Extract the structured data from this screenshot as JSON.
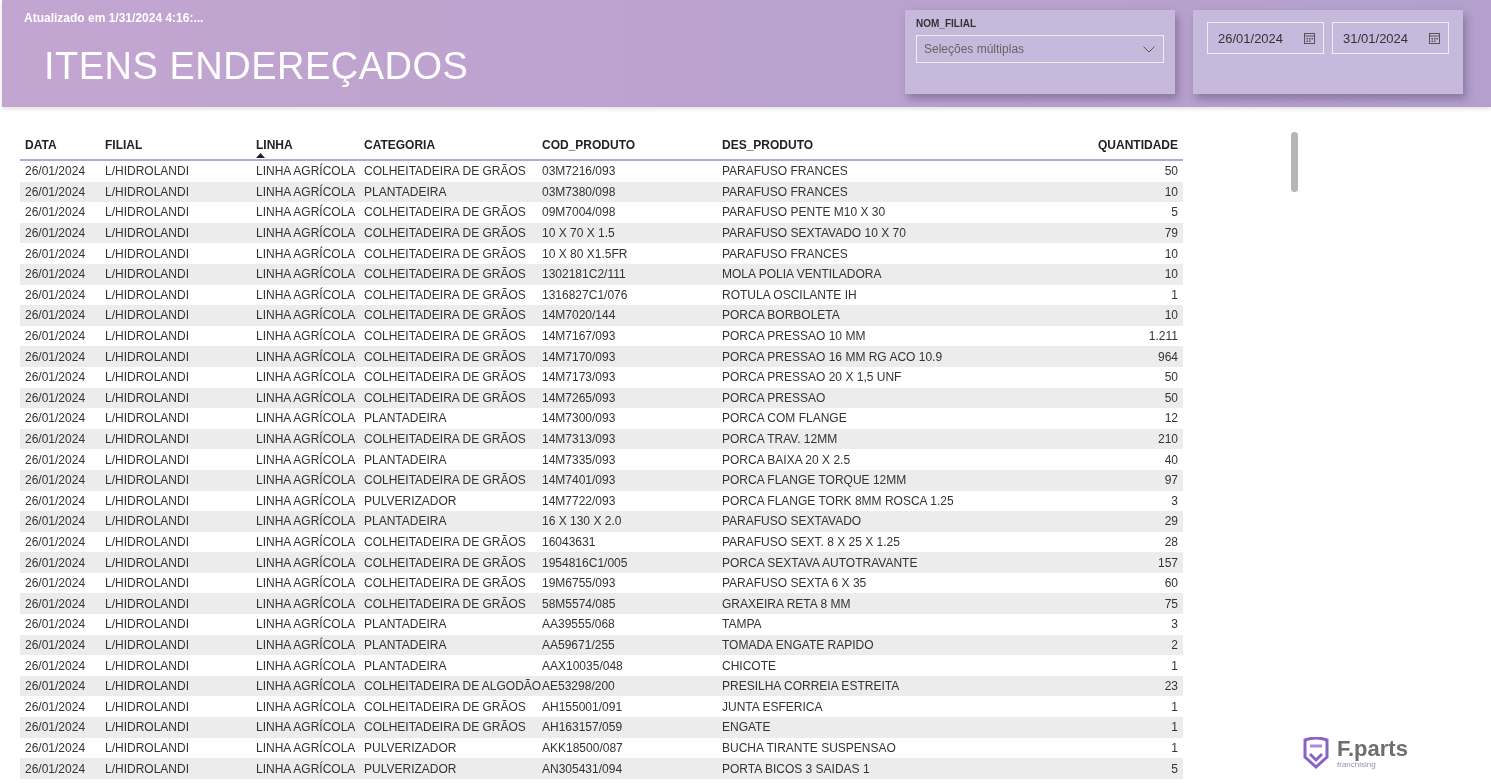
{
  "header": {
    "updated": "Atualizado em 1/31/2024 4:16:...",
    "title": "ITENS ENDEREÇADOS"
  },
  "slicers": {
    "branch": {
      "label": "NOM_FILIAL",
      "value": "Seleções múltiplas"
    },
    "date_range": {
      "start": "26/01/2024",
      "end": "31/01/2024"
    }
  },
  "table": {
    "columns": [
      {
        "label": "DATA",
        "sorted": false
      },
      {
        "label": "FILIAL",
        "sorted": false
      },
      {
        "label": "LINHA",
        "sorted": true
      },
      {
        "label": "CATEGORIA",
        "sorted": false
      },
      {
        "label": "COD_PRODUTO",
        "sorted": false
      },
      {
        "label": "DES_PRODUTO",
        "sorted": false
      },
      {
        "label": "QUANTIDADE",
        "sorted": false
      }
    ],
    "rows": [
      [
        "26/01/2024",
        "L/HIDROLANDI",
        "LINHA AGRÍCOLA",
        "COLHEITADEIRA DE GRÃOS",
        "03M7216/093",
        "PARAFUSO FRANCES",
        "50"
      ],
      [
        "26/01/2024",
        "L/HIDROLANDI",
        "LINHA AGRÍCOLA",
        "PLANTADEIRA",
        "03M7380/098",
        "PARAFUSO FRANCES",
        "10"
      ],
      [
        "26/01/2024",
        "L/HIDROLANDI",
        "LINHA AGRÍCOLA",
        "COLHEITADEIRA DE GRÃOS",
        "09M7004/098",
        "PARAFUSO PENTE M10 X 30",
        "5"
      ],
      [
        "26/01/2024",
        "L/HIDROLANDI",
        "LINHA AGRÍCOLA",
        "COLHEITADEIRA DE GRÃOS",
        "10 X 70 X 1.5",
        "PARAFUSO SEXTAVADO 10 X 70",
        "79"
      ],
      [
        "26/01/2024",
        "L/HIDROLANDI",
        "LINHA AGRÍCOLA",
        "COLHEITADEIRA DE GRÃOS",
        "10 X 80 X1.5FR",
        "PARAFUSO FRANCES",
        "10"
      ],
      [
        "26/01/2024",
        "L/HIDROLANDI",
        "LINHA AGRÍCOLA",
        "COLHEITADEIRA DE GRÃOS",
        "1302181C2/111",
        "MOLA POLIA VENTILADORA",
        "10"
      ],
      [
        "26/01/2024",
        "L/HIDROLANDI",
        "LINHA AGRÍCOLA",
        "COLHEITADEIRA DE GRÃOS",
        "1316827C1/076",
        "ROTULA OSCILANTE IH",
        "1"
      ],
      [
        "26/01/2024",
        "L/HIDROLANDI",
        "LINHA AGRÍCOLA",
        "COLHEITADEIRA DE GRÃOS",
        "14M7020/144",
        "PORCA BORBOLETA",
        "10"
      ],
      [
        "26/01/2024",
        "L/HIDROLANDI",
        "LINHA AGRÍCOLA",
        "COLHEITADEIRA DE GRÃOS",
        "14M7167/093",
        "PORCA PRESSAO 10 MM",
        "1.211"
      ],
      [
        "26/01/2024",
        "L/HIDROLANDI",
        "LINHA AGRÍCOLA",
        "COLHEITADEIRA DE GRÃOS",
        "14M7170/093",
        "PORCA PRESSAO 16 MM RG ACO 10.9",
        "964"
      ],
      [
        "26/01/2024",
        "L/HIDROLANDI",
        "LINHA AGRÍCOLA",
        "COLHEITADEIRA DE GRÃOS",
        "14M7173/093",
        "PORCA PRESSAO 20 X 1,5 UNF",
        "50"
      ],
      [
        "26/01/2024",
        "L/HIDROLANDI",
        "LINHA AGRÍCOLA",
        "COLHEITADEIRA DE GRÃOS",
        "14M7265/093",
        "PORCA PRESSAO",
        "50"
      ],
      [
        "26/01/2024",
        "L/HIDROLANDI",
        "LINHA AGRÍCOLA",
        "PLANTADEIRA",
        "14M7300/093",
        "PORCA COM FLANGE",
        "12"
      ],
      [
        "26/01/2024",
        "L/HIDROLANDI",
        "LINHA AGRÍCOLA",
        "COLHEITADEIRA DE GRÃOS",
        "14M7313/093",
        "PORCA TRAV. 12MM",
        "210"
      ],
      [
        "26/01/2024",
        "L/HIDROLANDI",
        "LINHA AGRÍCOLA",
        "PLANTADEIRA",
        "14M7335/093",
        "PORCA BAIXA 20 X 2.5",
        "40"
      ],
      [
        "26/01/2024",
        "L/HIDROLANDI",
        "LINHA AGRÍCOLA",
        "COLHEITADEIRA DE GRÃOS",
        "14M7401/093",
        "PORCA FLANGE TORQUE 12MM",
        "97"
      ],
      [
        "26/01/2024",
        "L/HIDROLANDI",
        "LINHA AGRÍCOLA",
        "PULVERIZADOR",
        "14M7722/093",
        "PORCA FLANGE TORK 8MM ROSCA 1.25",
        "3"
      ],
      [
        "26/01/2024",
        "L/HIDROLANDI",
        "LINHA AGRÍCOLA",
        "PLANTADEIRA",
        "16 X 130 X 2.0",
        "PARAFUSO SEXTAVADO",
        "29"
      ],
      [
        "26/01/2024",
        "L/HIDROLANDI",
        "LINHA AGRÍCOLA",
        "COLHEITADEIRA DE GRÃOS",
        "16043631",
        "PARAFUSO SEXT. 8 X 25 X 1.25",
        "28"
      ],
      [
        "26/01/2024",
        "L/HIDROLANDI",
        "LINHA AGRÍCOLA",
        "COLHEITADEIRA DE GRÃOS",
        "1954816C1/005",
        "PORCA SEXTAVA AUTOTRAVANTE",
        "157"
      ],
      [
        "26/01/2024",
        "L/HIDROLANDI",
        "LINHA AGRÍCOLA",
        "COLHEITADEIRA DE GRÃOS",
        "19M6755/093",
        "PARAFUSO SEXTA 6 X 35",
        "60"
      ],
      [
        "26/01/2024",
        "L/HIDROLANDI",
        "LINHA AGRÍCOLA",
        "COLHEITADEIRA DE GRÃOS",
        "58M5574/085",
        "GRAXEIRA RETA 8 MM",
        "75"
      ],
      [
        "26/01/2024",
        "L/HIDROLANDI",
        "LINHA AGRÍCOLA",
        "PLANTADEIRA",
        "AA39555/068",
        "TAMPA",
        "3"
      ],
      [
        "26/01/2024",
        "L/HIDROLANDI",
        "LINHA AGRÍCOLA",
        "PLANTADEIRA",
        "AA59671/255",
        "TOMADA ENGATE RAPIDO",
        "2"
      ],
      [
        "26/01/2024",
        "L/HIDROLANDI",
        "LINHA AGRÍCOLA",
        "PLANTADEIRA",
        "AAX10035/048",
        "CHICOTE",
        "1"
      ],
      [
        "26/01/2024",
        "L/HIDROLANDI",
        "LINHA AGRÍCOLA",
        "COLHEITADEIRA DE ALGODÃO",
        "AE53298/200",
        "PRESILHA CORREIA ESTREITA",
        "23"
      ],
      [
        "26/01/2024",
        "L/HIDROLANDI",
        "LINHA AGRÍCOLA",
        "COLHEITADEIRA DE GRÃOS",
        "AH155001/091",
        "JUNTA ESFERICA",
        "1"
      ],
      [
        "26/01/2024",
        "L/HIDROLANDI",
        "LINHA AGRÍCOLA",
        "COLHEITADEIRA DE GRÃOS",
        "AH163157/059",
        "ENGATE",
        "1"
      ],
      [
        "26/01/2024",
        "L/HIDROLANDI",
        "LINHA AGRÍCOLA",
        "PULVERIZADOR",
        "AKK18500/087",
        "BUCHA TIRANTE SUSPENSAO",
        "1"
      ],
      [
        "26/01/2024",
        "L/HIDROLANDI",
        "LINHA AGRÍCOLA",
        "PULVERIZADOR",
        "AN305431/094",
        "PORTA BICOS 3 SAIDAS 1",
        "5"
      ]
    ]
  },
  "logo": {
    "name": "F.parts",
    "tagline": "franchising"
  }
}
